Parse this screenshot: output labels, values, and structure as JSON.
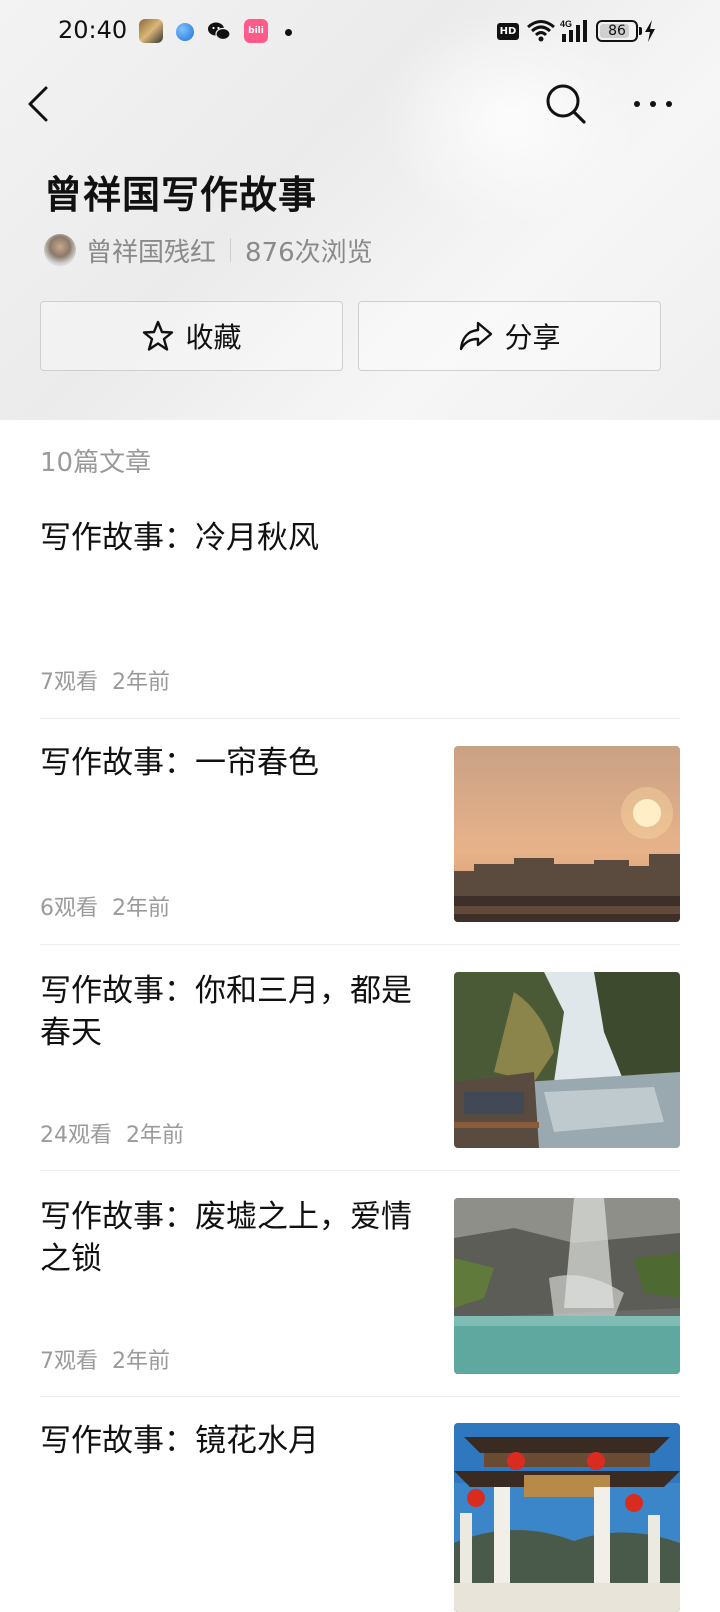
{
  "status_bar": {
    "time": "20:40",
    "hd": "HD",
    "network": "4G",
    "battery": "86",
    "battery_fraction": 0.86,
    "icons": [
      "game-app-icon",
      "browser-app-icon",
      "wechat-app-icon",
      "bilibili-app-icon",
      "notification-dot",
      "hd-badge",
      "wifi-icon",
      "signal-icon",
      "battery-icon",
      "charging-icon"
    ],
    "bilibili_text": "bili"
  },
  "nav": {
    "back_icon": "back-icon",
    "search_icon": "search-icon",
    "more_icon": "more-icon"
  },
  "collection": {
    "title": "曾祥国写作故事",
    "author": "曾祥国残红",
    "views": "876次浏览",
    "favorite_label": "收藏",
    "share_label": "分享",
    "article_count": "10篇文章"
  },
  "articles": [
    {
      "title": "写作故事：冷月秋风",
      "views": "7观看",
      "time": "2年前",
      "thumbnail": ""
    },
    {
      "title": "写作故事：一帘春色",
      "views": "6观看",
      "time": "2年前",
      "thumbnail": "sunset-cityscape"
    },
    {
      "title": "写作故事：你和三月，都是春天",
      "views": "24观看",
      "time": "2年前",
      "thumbnail": "river-with-trees"
    },
    {
      "title": "写作故事：废墟之上，爱情之锁",
      "views": "7观看",
      "time": "2年前",
      "thumbnail": "waterfall-pool"
    },
    {
      "title": "写作故事：镜花水月",
      "views": "",
      "time": "",
      "thumbnail": "chinese-gate-lanterns"
    }
  ],
  "colors": {
    "text_primary": "#111111",
    "text_secondary": "#8a8a8a",
    "divider": "#ececec",
    "header_bg": "#efefef"
  }
}
